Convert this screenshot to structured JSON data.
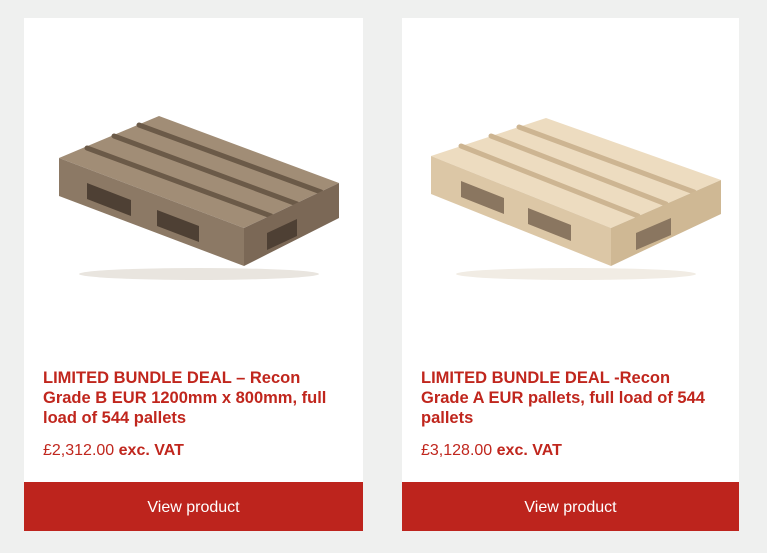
{
  "products": [
    {
      "title": "LIMITED BUNDLE DEAL – Recon Grade B EUR 1200mm x 800mm, full load of 544 pallets",
      "price": "£2,312.00",
      "price_suffix": "exc. VAT",
      "button_label": "View product",
      "image_icon": "grade-b-pallet-icon"
    },
    {
      "title": "LIMITED BUNDLE DEAL -Recon Grade A EUR pallets, full load of 544 pallets",
      "price": "£3,128.00",
      "price_suffix": "exc. VAT",
      "button_label": "View product",
      "image_icon": "grade-a-pallet-icon"
    }
  ],
  "colors": {
    "accent": "#c0261d",
    "button": "#bd241d",
    "background": "#eff0ef",
    "pallet_b": "#a89680",
    "pallet_a": "#eedcbd"
  }
}
